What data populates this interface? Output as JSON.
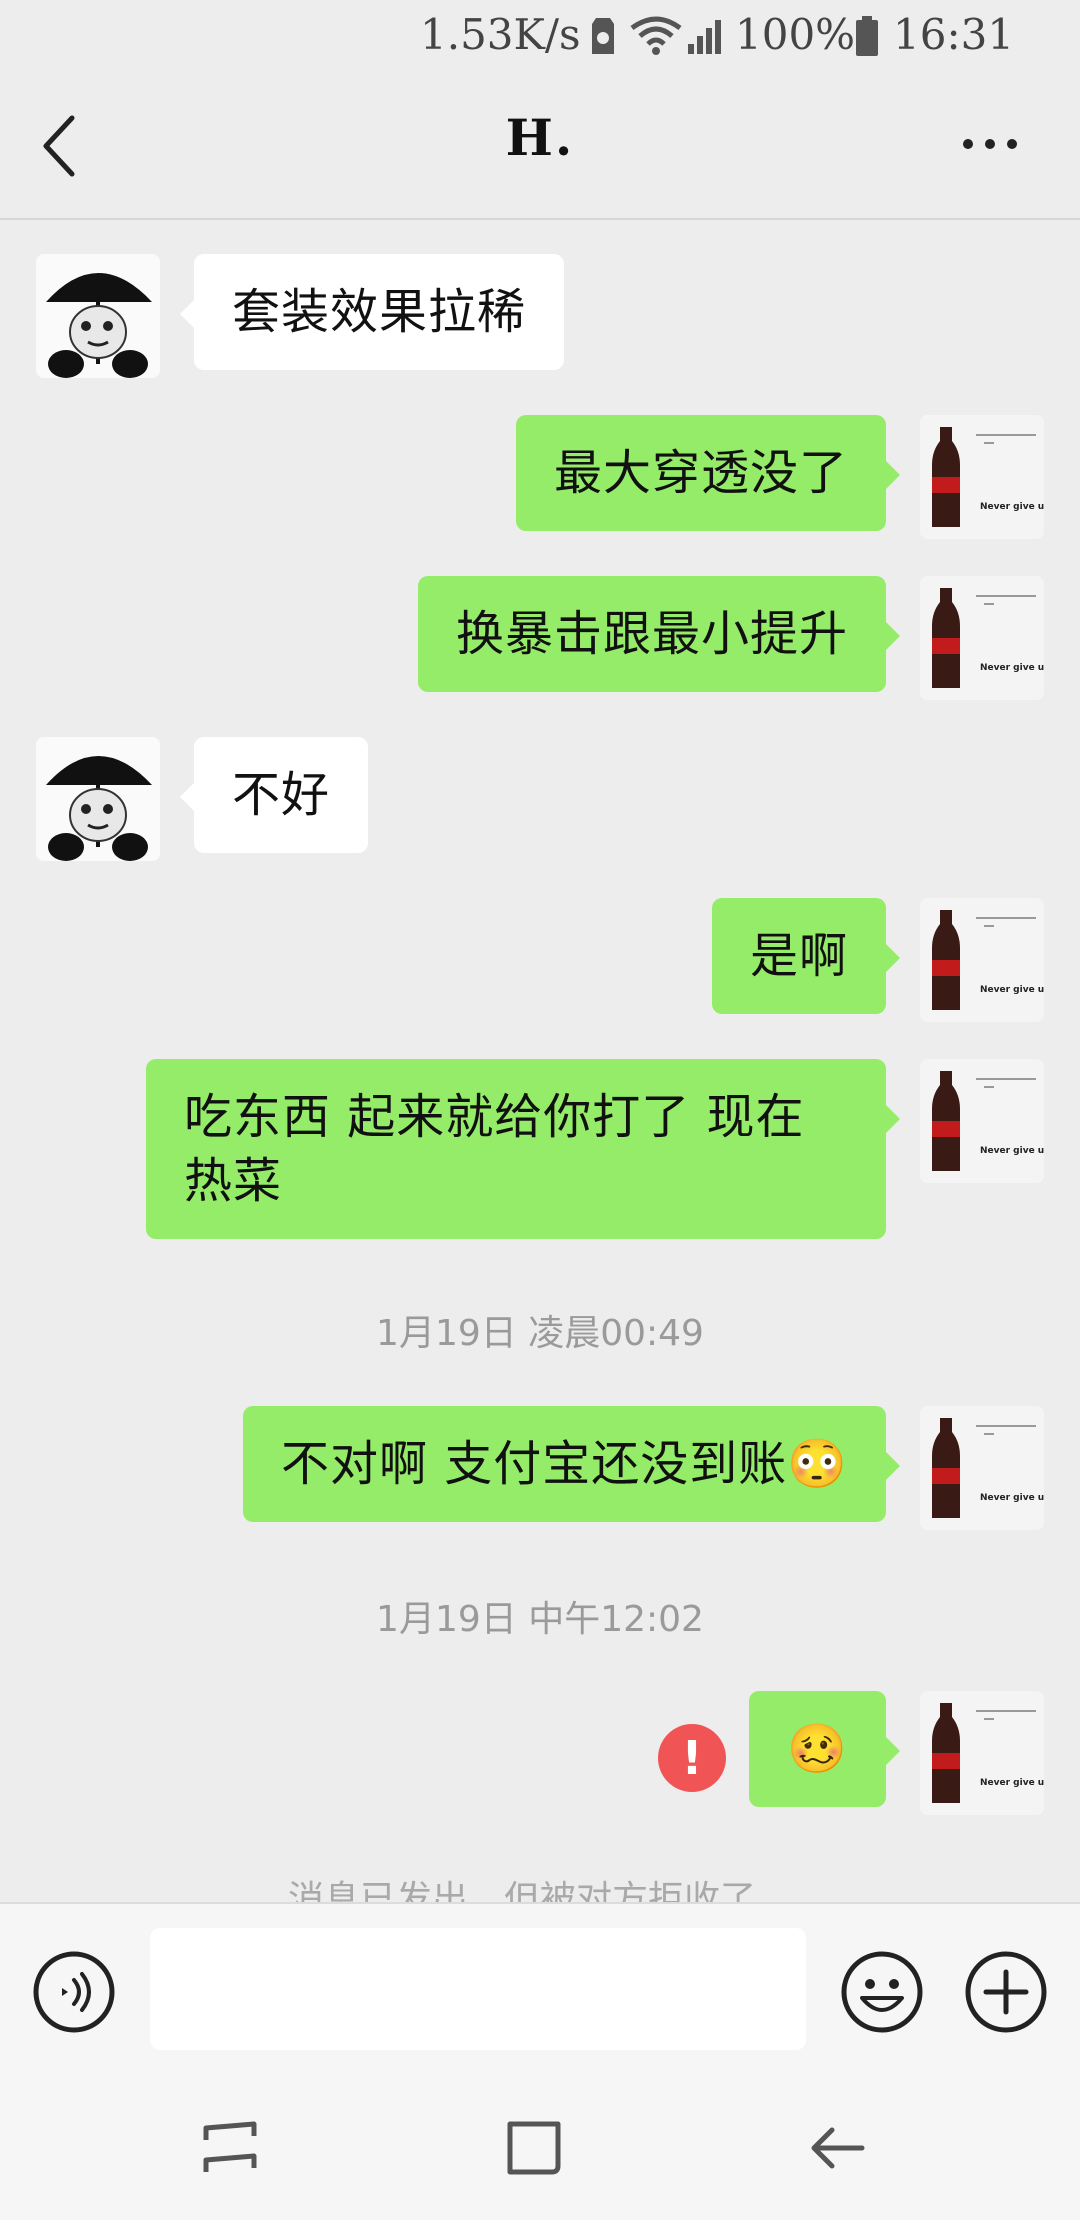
{
  "status_bar": {
    "speed": "1.53K/s",
    "battery": "100%",
    "time": "16:31"
  },
  "header": {
    "title": "H."
  },
  "messages": [
    {
      "side": "in",
      "text": "套装效果拉稀"
    },
    {
      "side": "out",
      "text": "最大穿透没了"
    },
    {
      "side": "out",
      "text": "换暴击跟最小提升"
    },
    {
      "side": "in",
      "text": "不好"
    },
    {
      "side": "out",
      "text": "是啊"
    },
    {
      "side": "out",
      "text": "吃东西 起来就给你打了 现在热菜"
    },
    {
      "side": "out",
      "text": "不对啊 支付宝还没到账😳"
    },
    {
      "side": "out",
      "text": "🥴"
    }
  ],
  "timestamps": [
    "1月19日 凌晨00:49",
    "1月19日 中午12:02"
  ],
  "system_notice": "消息已发出，但被对方拒收了。",
  "input": {
    "value": "",
    "placeholder": ""
  },
  "error_mark": "!",
  "avatar_self_caption": "Never give up!",
  "colors": {
    "background": "#ededed",
    "outgoing_bubble": "#95ec69",
    "incoming_bubble": "#ffffff",
    "error": "#f05454"
  }
}
